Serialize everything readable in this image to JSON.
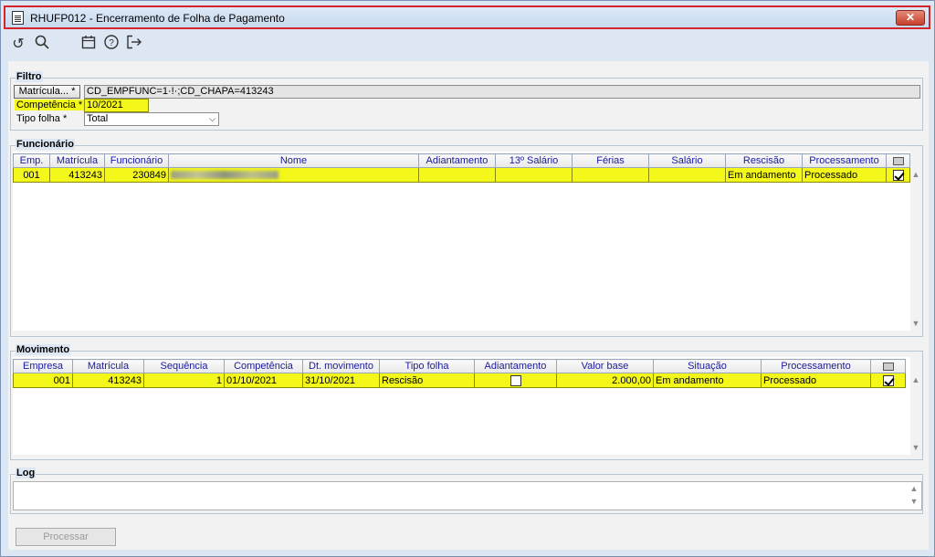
{
  "window": {
    "title": "RHUFP012 - Encerramento de Folha de Pagamento",
    "close_label": "✕"
  },
  "toolbar": {
    "icons": [
      "undo-icon",
      "search-icon",
      "calendar-icon",
      "help-icon",
      "exit-icon"
    ]
  },
  "filtro": {
    "title": "Filtro",
    "matricula_button": "Matrícula... *",
    "matricula_value": "CD_EMPFUNC=1·!·;CD_CHAPA=413243",
    "competencia_label": "Competência *",
    "competencia_value": "10/2021",
    "tipo_folha_label": "Tipo folha *",
    "tipo_folha_value": "Total"
  },
  "funcionario": {
    "title": "Funcionário",
    "columns": [
      "Emp.",
      "Matrícula",
      "Funcionário",
      "Nome",
      "Adiantamento",
      "13º Salário",
      "Férias",
      "Salário",
      "Rescisão",
      "Processamento"
    ],
    "rows": [
      {
        "emp": "001",
        "matricula": "413243",
        "funcionario": "230849",
        "nome": "",
        "adiantamento": "",
        "decimo": "",
        "ferias": "",
        "salario": "",
        "rescisao": "Em andamento",
        "processamento": "Processado",
        "checked": true
      }
    ]
  },
  "movimento": {
    "title": "Movimento",
    "columns": [
      "Empresa",
      "Matrícula",
      "Sequência",
      "Competência",
      "Dt. movimento",
      "Tipo folha",
      "Adiantamento",
      "Valor base",
      "Situação",
      "Processamento"
    ],
    "rows": [
      {
        "empresa": "001",
        "matricula": "413243",
        "sequencia": "1",
        "competencia": "01/10/2021",
        "dt_movimento": "31/10/2021",
        "tipo_folha": "Rescisão",
        "adiantamento_checked": false,
        "valor_base": "2.000,00",
        "situacao": "Em andamento",
        "processamento": "Processado",
        "checked": true
      }
    ]
  },
  "log": {
    "title": "Log"
  },
  "footer": {
    "processar_label": "Processar"
  },
  "colors": {
    "highlight": "#f4f71a",
    "title_border": "#d3252a"
  }
}
